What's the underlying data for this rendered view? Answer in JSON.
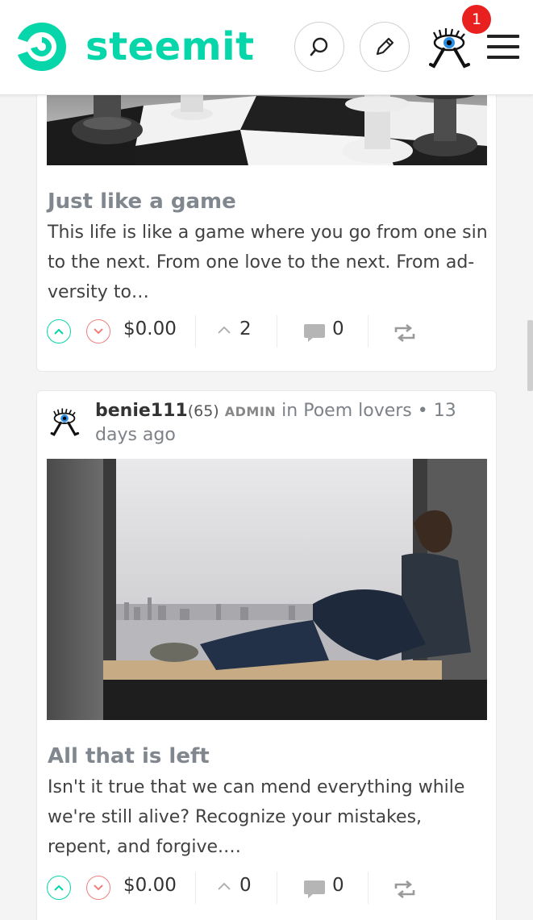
{
  "header": {
    "brand": "steemit",
    "notification_count": "1"
  },
  "posts": [
    {
      "title": "Just like a game",
      "excerpt": "This life is like a game where you go from one sin to the next. From one love to the next. From ad-versity to…",
      "payout": "$0.00",
      "votes": "2",
      "comments": "0"
    },
    {
      "author": "benie111",
      "reputation": "(65)",
      "role": "ADMIN",
      "community": "in Poem lovers",
      "bullet": "•",
      "time": "13 days ago",
      "title": "All that is left",
      "excerpt": "Isn't it true that we can mend everything while we're still alive? Recognize your mistakes, repent, and forgive.…",
      "payout": "$0.00",
      "votes": "0",
      "comments": "0"
    }
  ],
  "colors": {
    "brand": "#06d6a9",
    "upvote": "#06d6a9",
    "downvote": "#f07f7f",
    "badge": "#e8201f",
    "title": "#80878e"
  }
}
